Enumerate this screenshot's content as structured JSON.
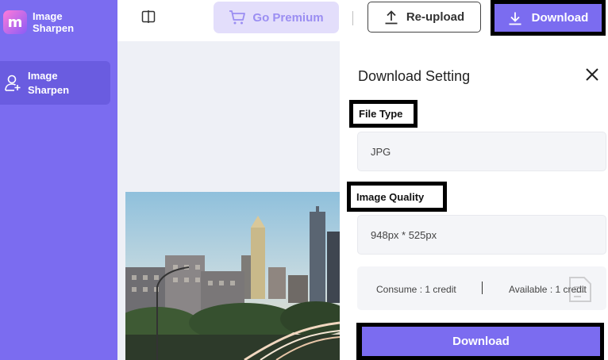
{
  "app": {
    "logo_letter": "m",
    "logo_text": "Image Sharpen"
  },
  "sidebar": {
    "items": [
      {
        "label": "Image Sharpen",
        "icon": "add-user-icon",
        "active": true
      }
    ]
  },
  "toolbar": {
    "premium_label": "Go Premium",
    "reupload_label": "Re-upload",
    "download_label": "Download"
  },
  "panel": {
    "title": "Download Setting",
    "file_type_label": "File Type",
    "file_type_value": "JPG",
    "quality_label": "Image Quality",
    "quality_value": "948px * 525px",
    "consume_text": "Consume : 1 credit",
    "available_text": "Available : 1 credit",
    "download_button": "Download"
  },
  "colors": {
    "accent": "#7b6cf0",
    "premium_bg": "#e3defb",
    "premium_text": "#9b8ef2"
  }
}
